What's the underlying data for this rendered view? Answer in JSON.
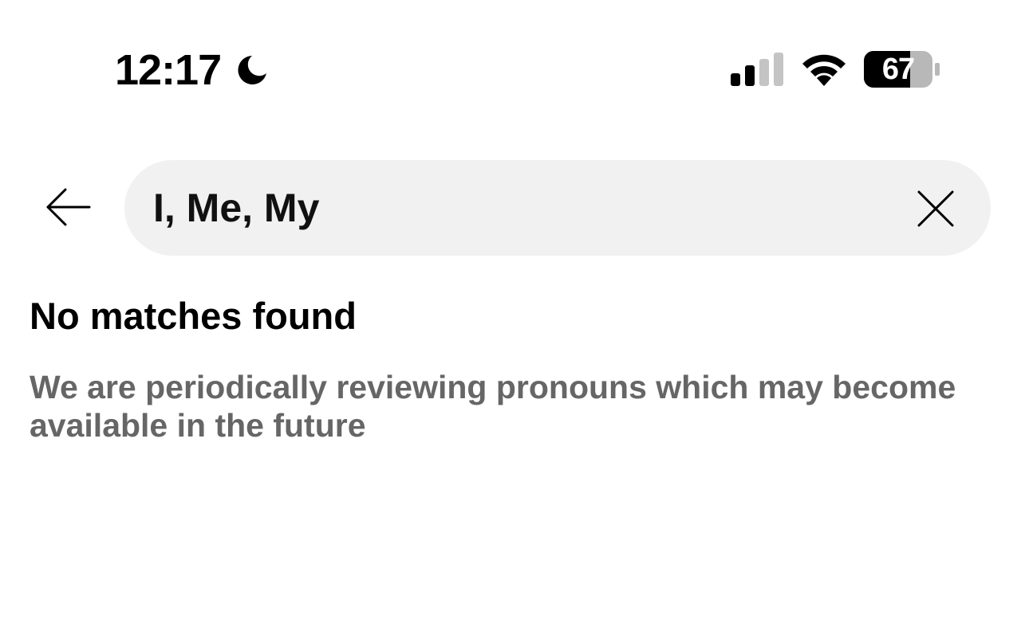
{
  "status_bar": {
    "time": "12:17",
    "battery_level": "67",
    "signal_bars_active": 2,
    "signal_bars_total": 4,
    "icons": [
      "moon-icon",
      "signal-icon",
      "wifi-icon",
      "battery-icon"
    ]
  },
  "search": {
    "value": "I, Me, My",
    "back_icon": "arrow-left-icon",
    "clear_icon": "close-icon"
  },
  "results": {
    "title": "No matches found",
    "description": "We are periodically reviewing pronouns which may become available in the future"
  },
  "colors": {
    "search_background": "#f1f1f1",
    "secondary_text": "#666666",
    "primary_text": "#000000"
  }
}
